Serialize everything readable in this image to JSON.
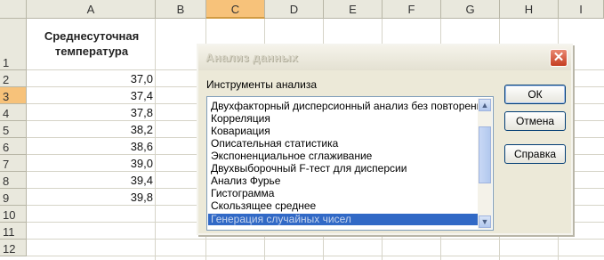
{
  "spreadsheet": {
    "columns": [
      "A",
      "B",
      "C",
      "D",
      "E",
      "F",
      "G",
      "H",
      "I"
    ],
    "rows": [
      "1",
      "2",
      "3",
      "4",
      "5",
      "6",
      "7",
      "8",
      "9",
      "10",
      "11",
      "12"
    ],
    "header_cell": "Среднесуточная температура",
    "values": [
      "37,0",
      "37,4",
      "37,8",
      "38,2",
      "38,6",
      "39,0",
      "39,4",
      "39,8"
    ]
  },
  "dialog": {
    "title": "Анализ данных",
    "tools_label": "Инструменты анализа",
    "tools": [
      "Двухфакторный дисперсионный анализ без повторений",
      "Корреляция",
      "Ковариация",
      "Описательная статистика",
      "Экспоненциальное сглаживание",
      "Двухвыборочный F-тест для дисперсии",
      "Анализ Фурье",
      "Гистограмма",
      "Скользящее среднее",
      "Генерация случайных чисел"
    ],
    "selected_tool": "Генерация случайных чисел",
    "buttons": {
      "ok": "ОК",
      "cancel": "Отмена",
      "help": "Справка"
    }
  },
  "colors": {
    "selection_header": "#f7c27a",
    "list_highlight": "#3169c6"
  }
}
